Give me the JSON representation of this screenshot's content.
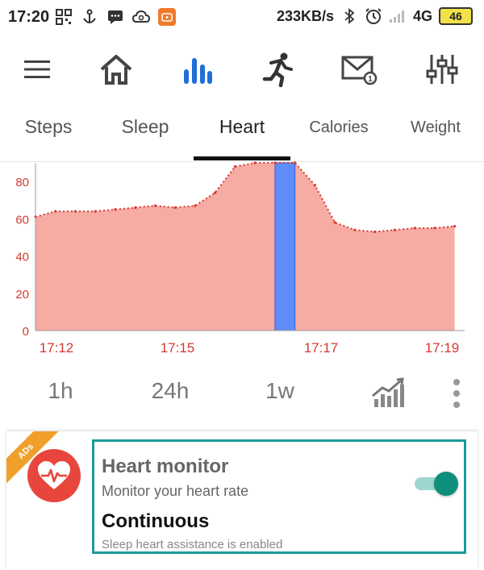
{
  "status_bar": {
    "time": "17:20",
    "network_speed": "233KB/s",
    "network_type": "4G",
    "battery": "46",
    "icons": [
      "grid-icon",
      "anchor-icon",
      "chat-icon",
      "cloud-icon",
      "app-notification-icon",
      "bluetooth-icon",
      "alarm-icon",
      "signal-icon"
    ]
  },
  "top_nav": {
    "items": [
      {
        "name": "menu-icon"
      },
      {
        "name": "home-icon"
      },
      {
        "name": "bar-chart-icon",
        "active": true
      },
      {
        "name": "running-icon"
      },
      {
        "name": "mail-icon"
      },
      {
        "name": "sliders-icon"
      }
    ],
    "accent": "#1e6fd9"
  },
  "tabs": [
    {
      "label": "Steps"
    },
    {
      "label": "Sleep"
    },
    {
      "label": "Heart",
      "active": true
    },
    {
      "label": "Calories"
    },
    {
      "label": "Weight"
    }
  ],
  "chart_data": {
    "type": "area",
    "y_ticks": [
      "80",
      "60",
      "40",
      "20",
      "0"
    ],
    "x_ticks": [
      "17:12",
      "17:15",
      "17:17",
      "17:19"
    ],
    "ylim": [
      0,
      90
    ],
    "fill_color": "#f6aba3",
    "line_color": "#d43a2f",
    "highlight_color": "#5f8cfb",
    "x": [
      "17:12:00",
      "17:12:20",
      "17:12:40",
      "17:13:00",
      "17:13:20",
      "17:13:40",
      "17:14:00",
      "17:14:20",
      "17:14:40",
      "17:15:00",
      "17:15:20",
      "17:15:40",
      "17:16:00",
      "17:16:20",
      "17:16:40",
      "17:17:00",
      "17:17:20",
      "17:17:40",
      "17:18:00",
      "17:18:20",
      "17:18:40",
      "17:19:00"
    ],
    "values": [
      61,
      64,
      64,
      64,
      65,
      66,
      67,
      66,
      67,
      74,
      88,
      90,
      90,
      90,
      78,
      58,
      54,
      53,
      54,
      55,
      55,
      56
    ],
    "highlight_range": [
      "17:16:00",
      "17:16:20"
    ]
  },
  "time_ranges": [
    {
      "label": "1h"
    },
    {
      "label": "24h"
    },
    {
      "label": "1w"
    }
  ],
  "card": {
    "badge": "ADs",
    "title": "Heart monitor",
    "subtitle": "Monitor your heart rate",
    "mode": "Continuous",
    "note": "Sleep heart assistance is enabled",
    "toggle_on": true
  }
}
